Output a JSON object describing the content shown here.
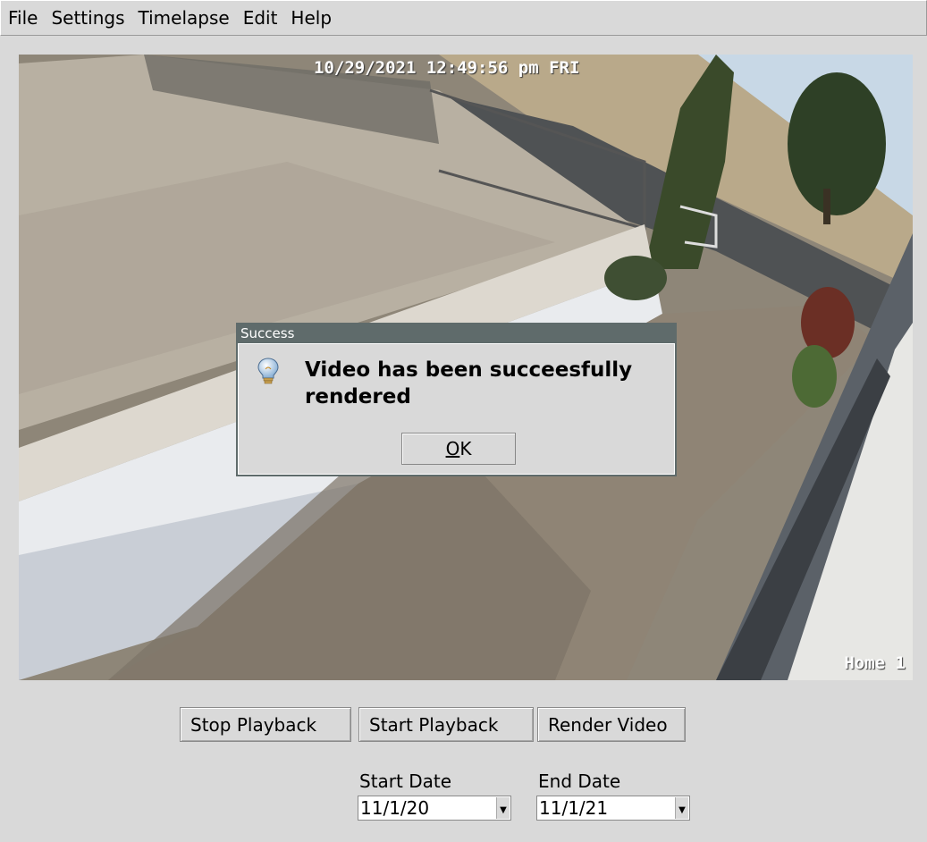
{
  "menu": {
    "items": [
      "File",
      "Settings",
      "Timelapse",
      "Edit",
      "Help"
    ]
  },
  "camera": {
    "timestamp": "10/29/2021 12:49:56 pm FRI",
    "channel": "Home 1"
  },
  "dialog": {
    "title": "Success",
    "message": "Video has been succeesfully rendered",
    "ok_mnemonic": "O",
    "ok_rest": "K",
    "icon": "lightbulb-icon"
  },
  "controls": {
    "stop_label": "Stop Playback",
    "start_label": "Start Playback",
    "render_label": "Render Video"
  },
  "dates": {
    "start_label": "Start Date",
    "start_value": "11/1/20",
    "end_label": "End Date",
    "end_value": "11/1/21"
  }
}
